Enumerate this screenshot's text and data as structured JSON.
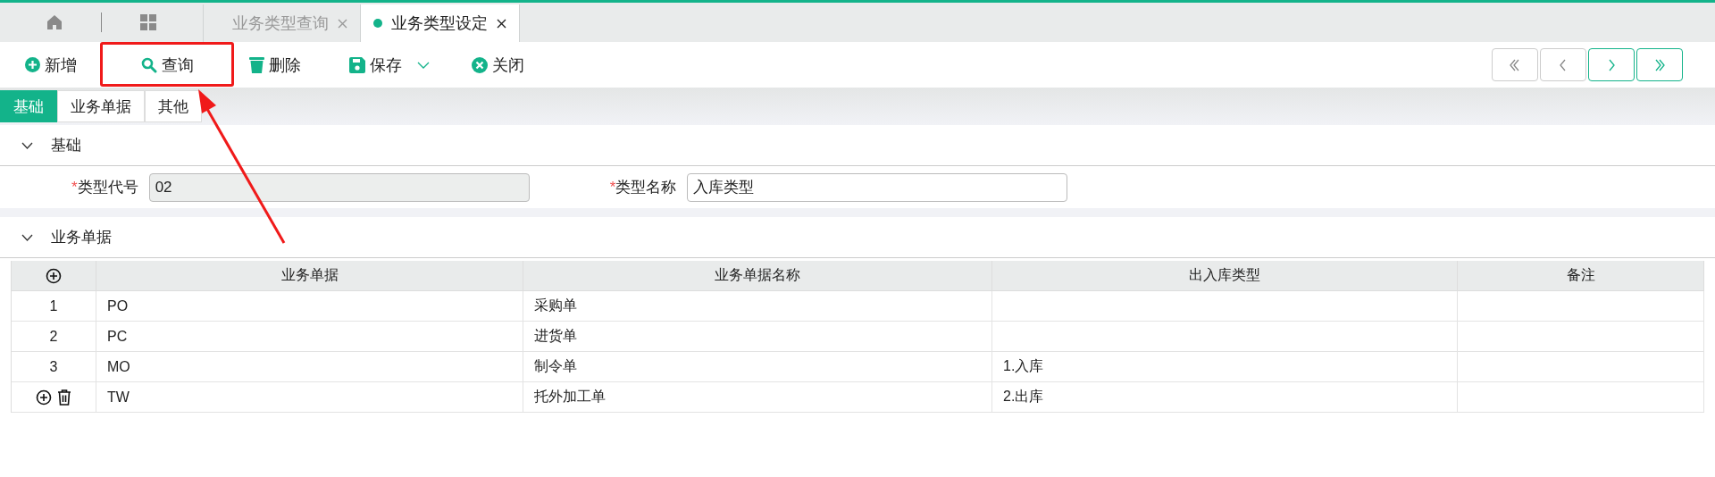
{
  "tabs": [
    {
      "label": "业务类型查询",
      "selected": false
    },
    {
      "label": "业务类型设定",
      "selected": true
    }
  ],
  "toolbar": [
    {
      "kind": "add",
      "label": "新增",
      "has_menu": false
    },
    {
      "kind": "search",
      "label": "查询",
      "has_menu": false
    },
    {
      "kind": "delete",
      "label": "删除",
      "has_menu": false
    },
    {
      "kind": "save",
      "label": "保存",
      "has_menu": true
    },
    {
      "kind": "close",
      "label": "关闭",
      "has_menu": false
    }
  ],
  "nav_buttons": [
    {
      "kind": "first",
      "disabled": true
    },
    {
      "kind": "prev",
      "disabled": true
    },
    {
      "kind": "next",
      "disabled": false
    },
    {
      "kind": "last",
      "disabled": false
    }
  ],
  "sub_tabs": [
    {
      "label": "基础",
      "selected": true
    },
    {
      "label": "业务单据",
      "selected": false
    },
    {
      "label": "其他",
      "selected": false
    }
  ],
  "basic_section": {
    "title": "基础",
    "expanded": true,
    "fields": [
      {
        "label": "类型代号",
        "required_mark": "*",
        "value": "02",
        "disabled": true
      },
      {
        "label": "类型名称",
        "required_mark": "*",
        "value": "入库类型",
        "disabled": false
      }
    ]
  },
  "documents_section": {
    "title": "业务单据",
    "expanded": true,
    "columns": [
      "业务单据",
      "业务单据名称",
      "出入库类型",
      "备注"
    ],
    "rows": [
      {
        "kind": "numbered",
        "index": "1",
        "cells": [
          "PO",
          "采购单",
          "",
          ""
        ]
      },
      {
        "kind": "numbered",
        "index": "2",
        "cells": [
          "PC",
          "进货单",
          "",
          ""
        ]
      },
      {
        "kind": "numbered",
        "index": "3",
        "cells": [
          "MO",
          "制令单",
          "1.入库",
          ""
        ]
      },
      {
        "kind": "editing",
        "cells": [
          "TW",
          "托外加工单",
          "2.出库",
          ""
        ]
      }
    ]
  }
}
